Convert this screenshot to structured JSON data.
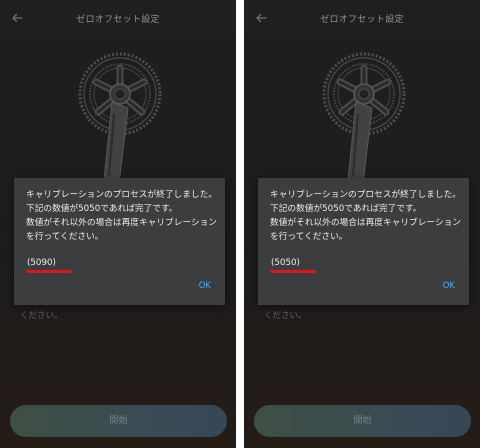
{
  "colors": {
    "background_top": "#2a2b2e",
    "dialog_bg": "#3c3d3f",
    "ok_text": "#49aef3",
    "annotation_red": "#e0141b",
    "start_button": "#4f6a74"
  },
  "icons": {
    "back": "arrow-left-icon",
    "crankset": "crankset-icon"
  },
  "screens": [
    {
      "title": "ゼロオフセット設定",
      "dialog": {
        "message": "キャリブレーションのプロセスが終了しました。\n下記の数値が5050であれば完了です。\n数値がそれ以外の場合は再度キャリブレーションを行ってください。",
        "value": "(5090)",
        "ok_label": "OK"
      },
      "background_text": "ください。",
      "start_label": "開始"
    },
    {
      "title": "ゼロオフセット設定",
      "dialog": {
        "message": "キャリブレーションのプロセスが終了しました。\n下記の数値が5050であれば完了です。\n数値がそれ以外の場合は再度キャリブレーションを行ってください。",
        "value": "(5050)",
        "ok_label": "OK"
      },
      "background_text": "ください。",
      "start_label": "開始"
    }
  ]
}
